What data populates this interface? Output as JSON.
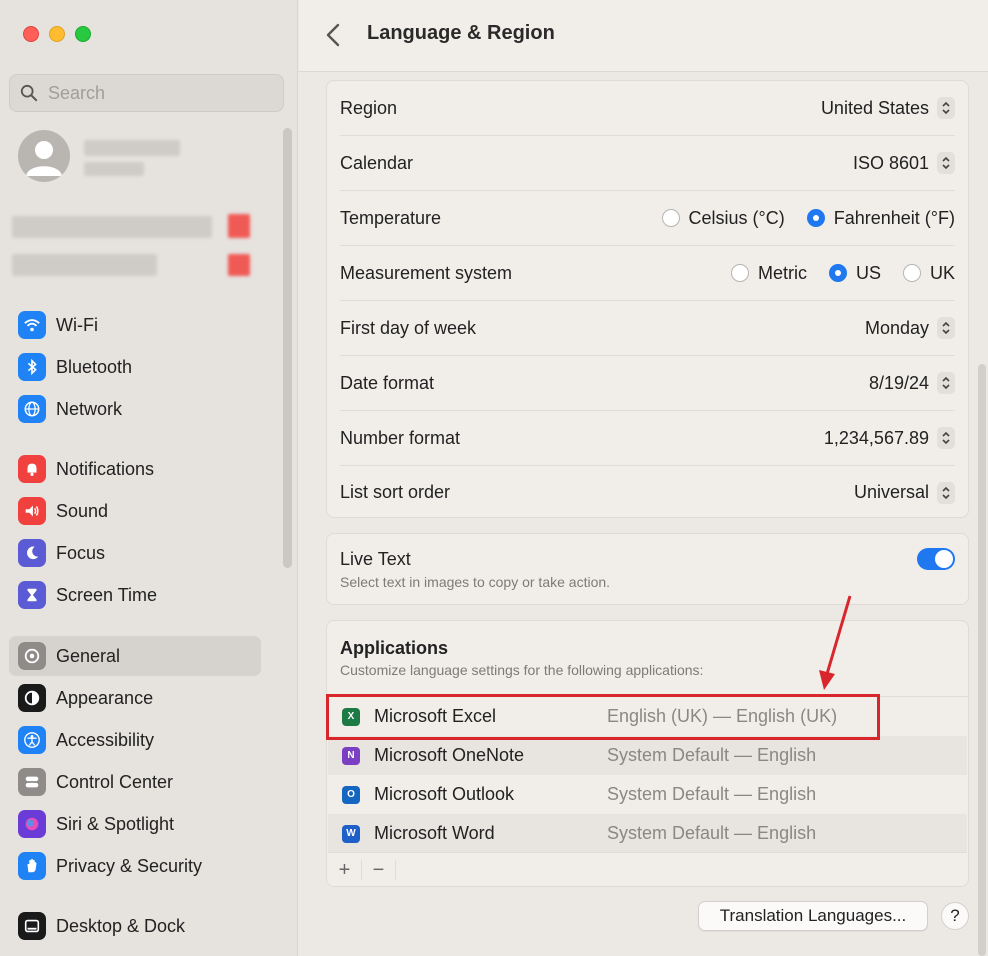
{
  "sidebar": {
    "search_placeholder": "Search",
    "groups": [
      [
        {
          "label": "Wi-Fi",
          "icon": "wifi-icon",
          "color": "#1f82f5"
        },
        {
          "label": "Bluetooth",
          "icon": "bluetooth-icon",
          "color": "#1f82f5"
        },
        {
          "label": "Network",
          "icon": "globe-icon",
          "color": "#1f82f5"
        }
      ],
      [
        {
          "label": "Notifications",
          "icon": "bell-icon",
          "color": "#f0413e"
        },
        {
          "label": "Sound",
          "icon": "speaker-icon",
          "color": "#f0413e"
        },
        {
          "label": "Focus",
          "icon": "moon-icon",
          "color": "#5b5bd6"
        },
        {
          "label": "Screen Time",
          "icon": "hourglass-icon",
          "color": "#5b5bd6"
        }
      ],
      [
        {
          "label": "General",
          "icon": "gear-icon",
          "color": "#8e8b88",
          "selected": true
        },
        {
          "label": "Appearance",
          "icon": "appearance-icon",
          "color": "#1a1a1a"
        },
        {
          "label": "Accessibility",
          "icon": "accessibility-icon",
          "color": "#1f82f5"
        },
        {
          "label": "Control Center",
          "icon": "control-center-icon",
          "color": "#8e8b88"
        },
        {
          "label": "Siri & Spotlight",
          "icon": "siri-icon",
          "color": "#6a3bd6"
        },
        {
          "label": "Privacy & Security",
          "icon": "hand-icon",
          "color": "#1f82f5"
        }
      ],
      [
        {
          "label": "Desktop & Dock",
          "icon": "dock-icon",
          "color": "#1a1a1a"
        }
      ]
    ]
  },
  "header": {
    "title": "Language & Region"
  },
  "settings": {
    "region": {
      "label": "Region",
      "value": "United States"
    },
    "calendar": {
      "label": "Calendar",
      "value": "ISO 8601"
    },
    "temperature": {
      "label": "Temperature",
      "options": [
        "Celsius (°C)",
        "Fahrenheit (°F)"
      ],
      "selected": "Fahrenheit (°F)"
    },
    "measurement": {
      "label": "Measurement system",
      "options": [
        "Metric",
        "US",
        "UK"
      ],
      "selected": "US"
    },
    "first_day": {
      "label": "First day of week",
      "value": "Monday"
    },
    "date_format": {
      "label": "Date format",
      "value": "8/19/24"
    },
    "number_format": {
      "label": "Number format",
      "value": "1,234,567.89"
    },
    "sort_order": {
      "label": "List sort order",
      "value": "Universal"
    }
  },
  "live_text": {
    "title": "Live Text",
    "subtitle": "Select text in images to copy or take action.",
    "enabled": true
  },
  "applications": {
    "title": "Applications",
    "subtitle": "Customize language settings for the following applications:",
    "items": [
      {
        "name": "Microsoft Excel",
        "lang": "English (UK) — English (UK)",
        "letter": "X",
        "color": "#1d7a45"
      },
      {
        "name": "Microsoft OneNote",
        "lang": "System Default — English",
        "letter": "N",
        "color": "#7b3fc4"
      },
      {
        "name": "Microsoft Outlook",
        "lang": "System Default — English",
        "letter": "O",
        "color": "#1466c0"
      },
      {
        "name": "Microsoft Word",
        "lang": "System Default — English",
        "letter": "W",
        "color": "#1f5fc8"
      }
    ],
    "add": "+",
    "remove": "−"
  },
  "buttons": {
    "translation": "Translation Languages...",
    "help": "?"
  },
  "colors": {
    "accent": "#1f78f0",
    "annotation": "#d9262c"
  }
}
